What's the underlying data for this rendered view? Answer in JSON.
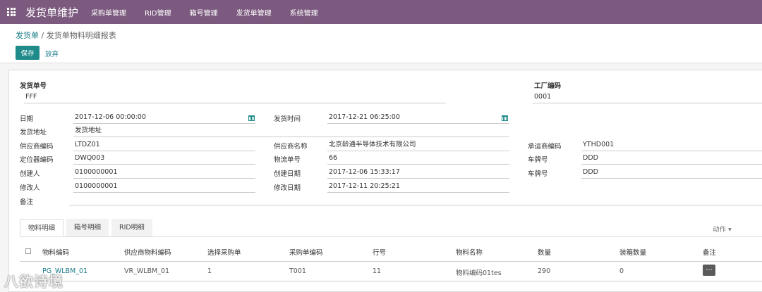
{
  "nav": {
    "app_title": "发货单维护",
    "menu": [
      "采购单管理",
      "RID管理",
      "箱号管理",
      "发货单管理",
      "系统管理"
    ]
  },
  "breadcrumb": {
    "parent": "发货单",
    "separator": " / ",
    "current": "发货单物料明细报表"
  },
  "buttons": {
    "save": "保存",
    "discard": "放弃"
  },
  "form": {
    "ship_no_label": "发货单号",
    "ship_no": "FFF",
    "factory_label": "工厂编码",
    "factory": "0001",
    "date_label": "日期",
    "date": "2017-12-06 00:00:00",
    "ship_time_label": "发货时间",
    "ship_time": "2017-12-21 06:25:00",
    "ship_addr_label": "发货地址",
    "ship_addr": "发货地址",
    "supplier_code_label": "供应商编码",
    "supplier_code": "LTDZ01",
    "supplier_name_label": "供应商名称",
    "supplier_name": "北京龄通半导体技术有限公司",
    "carrier_code_label": "承运商编码",
    "carrier_code": "YTHD001",
    "locator_label": "定位器编码",
    "locator": "DWQ003",
    "logistics_label": "物流单号",
    "logistics": "66",
    "plate1_label": "车牌号",
    "plate1": "DDD",
    "creator_label": "创建人",
    "creator": "0100000001",
    "created_label": "创建日期",
    "created": "2017-12-06 15:33:17",
    "plate2_label": "车牌号",
    "plate2": "DDD",
    "modifier_label": "修改人",
    "modifier": "0100000001",
    "modified_label": "修改日期",
    "modified": "2017-12-11 20:25:21",
    "remark_label": "备注"
  },
  "tabs": [
    "物料明细",
    "箱号明细",
    "RID明细"
  ],
  "action_label": "动作 ▾",
  "table": {
    "headers": [
      "物料编码",
      "供应商物料编码",
      "选择采购单",
      "采购单编码",
      "行号",
      "物料名称",
      "数量",
      "装箱数量",
      "备注"
    ],
    "rows": [
      [
        "PG_WLBM_01",
        "VR_WLBM_01",
        "1",
        "T001",
        "11",
        "物料编码01tes",
        "290",
        "0"
      ]
    ],
    "row_button": "..."
  },
  "watermark": "八欲诗境"
}
